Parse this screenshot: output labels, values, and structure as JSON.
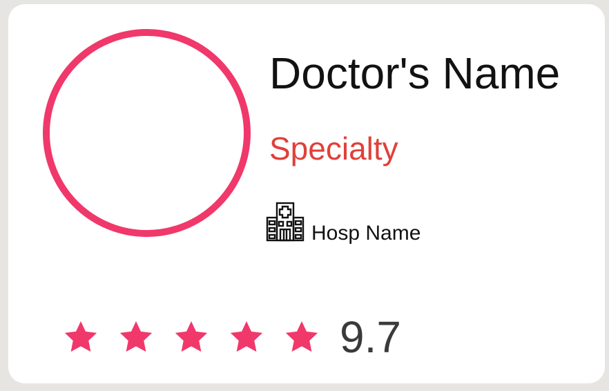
{
  "card": {
    "doctor_name": "Doctor's Name",
    "specialty": "Specialty",
    "hospital": {
      "icon": "hospital-building-icon",
      "name": "Hosp Name"
    },
    "rating": {
      "stars_filled": 5,
      "stars_total": 5,
      "value": "9.7"
    }
  },
  "colors": {
    "accent": "#f0386b",
    "specialty": "#e0403a",
    "text": "#121212",
    "rating_text": "#3a3a3a",
    "background": "#e6e5e1",
    "card": "#ffffff"
  }
}
